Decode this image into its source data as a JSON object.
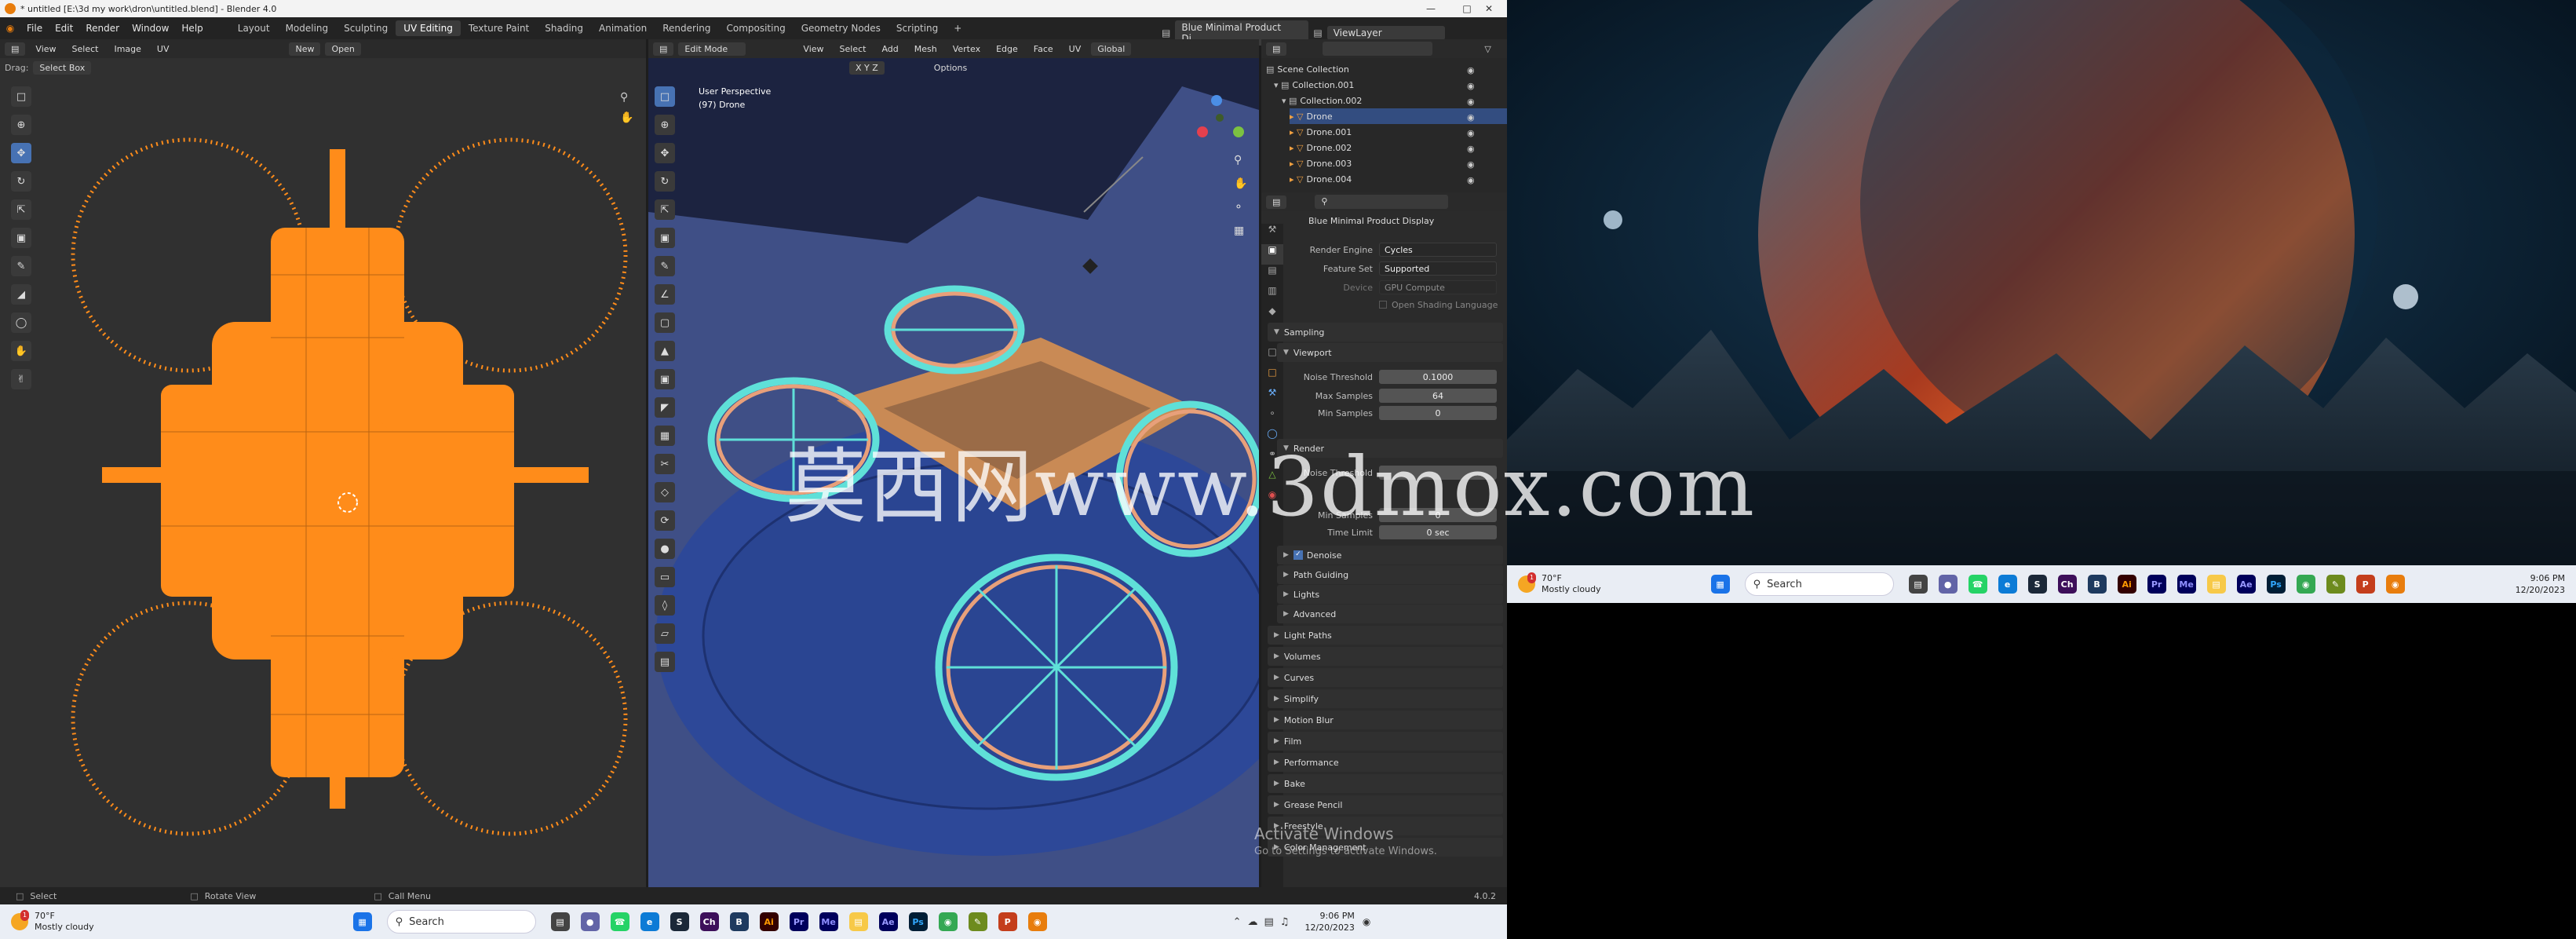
{
  "window": {
    "title": "* untitled [E:\\3d my work\\dron\\untitled.blend] - Blender 4.0"
  },
  "menu": [
    "File",
    "Edit",
    "Render",
    "Window",
    "Help"
  ],
  "workspaces": [
    "Layout",
    "Modeling",
    "Sculpting",
    "UV Editing",
    "Texture Paint",
    "Shading",
    "Animation",
    "Rendering",
    "Compositing",
    "Geometry Nodes",
    "Scripting"
  ],
  "workspace_add": "+",
  "scene_name": "Blue Minimal Product Di...",
  "view_layer": "ViewLayer",
  "uv_header": {
    "view": "View",
    "select": "Select",
    "image": "Image",
    "uv": "UV",
    "new": "New",
    "open": "Open",
    "drag_label": "Drag:",
    "drag_mode": "Select Box"
  },
  "vp_header": {
    "mode": "Edit Mode",
    "view": "View",
    "select": "Select",
    "add": "Add",
    "mesh": "Mesh",
    "vertex": "Vertex",
    "edge": "Edge",
    "face": "Face",
    "uv": "UV",
    "orientation": "Global",
    "options": "Options",
    "axes": "X Y Z"
  },
  "viewport_overlay": {
    "perspective": "User Perspective",
    "object": "(97) Drone"
  },
  "outliner": {
    "search": "",
    "rows": [
      {
        "label": "Scene Collection",
        "indent": 0
      },
      {
        "label": "Collection.001",
        "indent": 1
      },
      {
        "label": "Collection.002",
        "indent": 2
      },
      {
        "label": "Drone",
        "indent": 3
      },
      {
        "label": "Drone.001",
        "indent": 3
      },
      {
        "label": "Drone.002",
        "indent": 3
      },
      {
        "label": "Drone.003",
        "indent": 3
      },
      {
        "label": "Drone.004",
        "indent": 3
      }
    ]
  },
  "properties": {
    "scene_title": "Blue Minimal Product Display",
    "render_engine_label": "Render Engine",
    "render_engine": "Cycles",
    "feature_set_label": "Feature Set",
    "feature_set": "Supported",
    "device_label": "Device",
    "device": "GPU Compute",
    "osl_label": "Open Shading Language",
    "sampling": "Sampling",
    "viewport": "Viewport",
    "noise_threshold_label": "Noise Threshold",
    "noise_threshold": "0.1000",
    "max_samples_label": "Max Samples",
    "max_samples": "64",
    "min_samples_label": "Min Samples",
    "min_samples": "0",
    "render": "Render",
    "render_noise_label": "Noise Threshold",
    "render_min_samples_label": "Min Samples",
    "render_min_samples": "0",
    "time_limit_label": "Time Limit",
    "time_limit": "0 sec",
    "denoise": "Denoise",
    "path_guiding": "Path Guiding",
    "lights": "Lights",
    "advanced": "Advanced",
    "panels": [
      "Light Paths",
      "Volumes",
      "Curves",
      "Simplify",
      "Motion Blur",
      "Film",
      "Performance",
      "Bake",
      "Grease Pencil",
      "Freestyle",
      "Color Management"
    ]
  },
  "status_bar": {
    "select": "Select",
    "rotate": "Rotate View",
    "menu": "Call Menu",
    "version": "4.0.2"
  },
  "taskbar_left": {
    "temp": "70°F",
    "weather": "Mostly cloudy",
    "search": "Search",
    "time": "9:06 PM",
    "date": "12/20/2023",
    "badge": "1"
  },
  "taskbar_right": {
    "temp": "70°F",
    "weather": "Mostly cloudy",
    "search": "Search",
    "time": "9:06 PM",
    "date": "12/20/2023",
    "badge": "1"
  },
  "watermark": {
    "text": "莫西网www.3dmox.com"
  },
  "activate_windows": {
    "title": "Activate Windows",
    "subtitle": "Go to Settings to activate Windows."
  },
  "colors": {
    "accent": "#4772b3",
    "uv_mesh": "#ff8c1a",
    "wire": "#5fe0d8"
  }
}
